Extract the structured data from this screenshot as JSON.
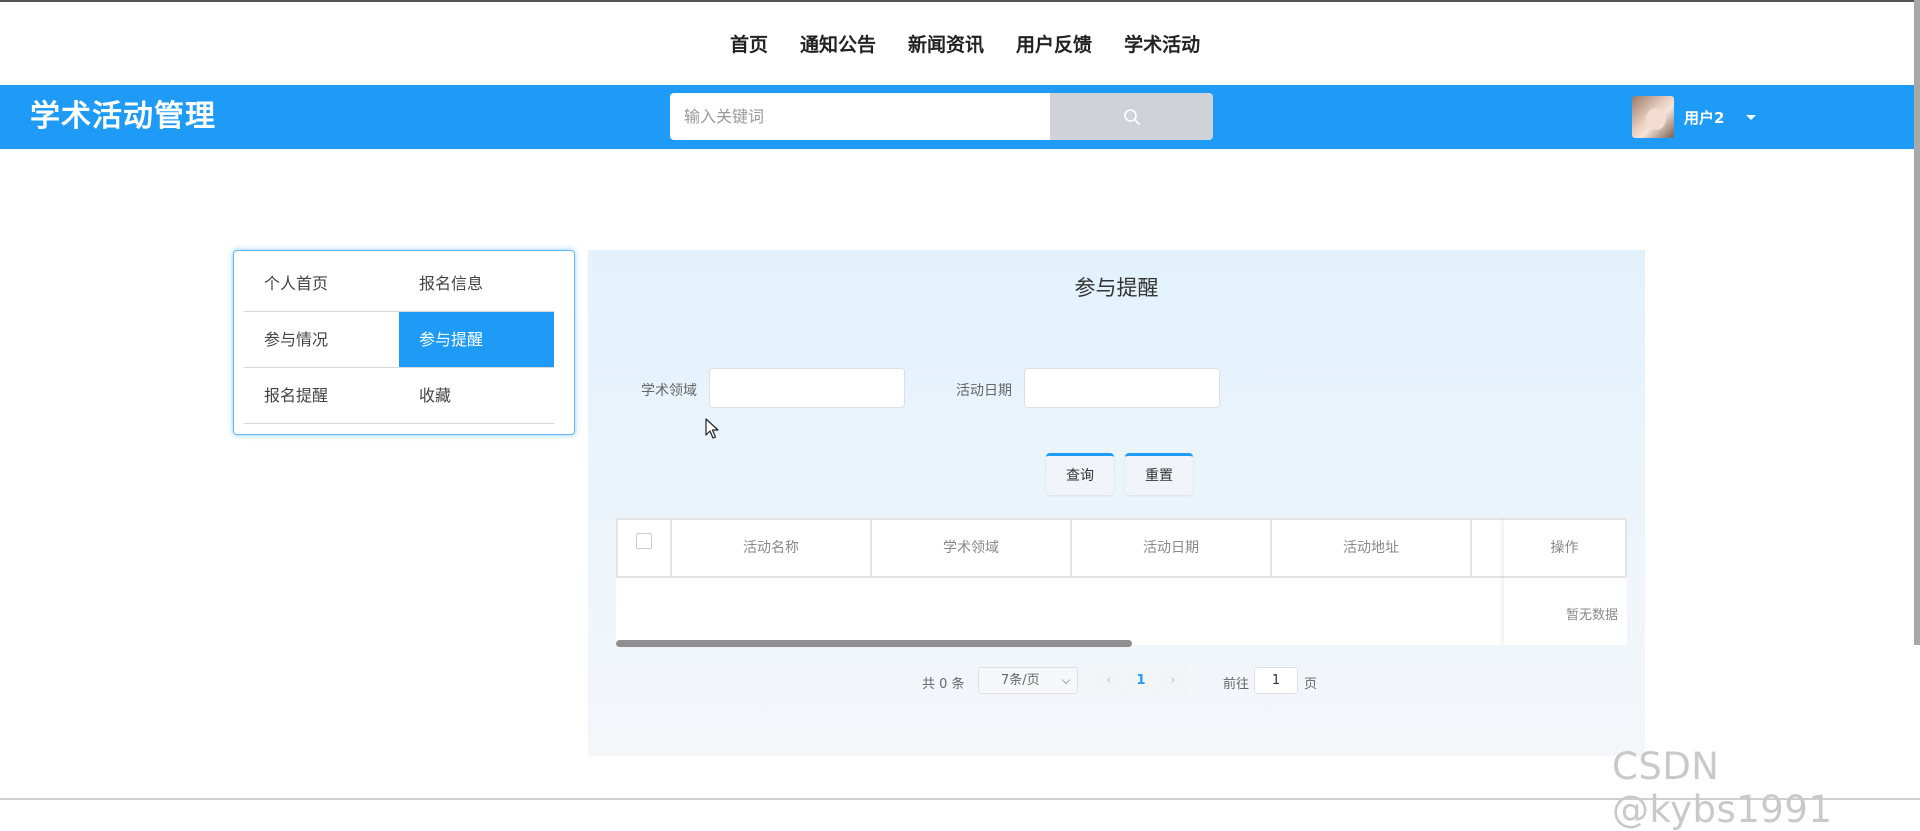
{
  "top_nav": {
    "items": [
      "首页",
      "通知公告",
      "新闻资讯",
      "用户反馈",
      "学术活动"
    ]
  },
  "header": {
    "brand": "学术活动管理",
    "search": {
      "placeholder": "输入关键词",
      "value": ""
    },
    "user": {
      "name": "用户2"
    }
  },
  "side_menu": {
    "items": [
      {
        "label": "个人首页",
        "active": false
      },
      {
        "label": "报名信息",
        "active": false
      },
      {
        "label": "参与情况",
        "active": false
      },
      {
        "label": "参与提醒",
        "active": true
      },
      {
        "label": "报名提醒",
        "active": false
      },
      {
        "label": "收藏",
        "active": false
      }
    ]
  },
  "panel": {
    "title": "参与提醒",
    "filters": {
      "field_label": "学术领域",
      "field_value": "",
      "date_label": "活动日期",
      "date_value": ""
    },
    "buttons": {
      "query": "查询",
      "reset": "重置"
    },
    "table": {
      "columns": [
        "活动名称",
        "学术领域",
        "活动日期",
        "活动地址"
      ],
      "action_column": "操作",
      "empty_text": "暂无数据",
      "rows": []
    },
    "pagination": {
      "total_text": "共 0 条",
      "page_size": "7条/页",
      "current_page": "1",
      "goto_label": "前往",
      "goto_value": "1",
      "page_suffix": "页"
    }
  },
  "watermark": "CSDN @kybs1991",
  "colors": {
    "primary": "#1e9bf7",
    "search_button": "#cfd3d9"
  }
}
